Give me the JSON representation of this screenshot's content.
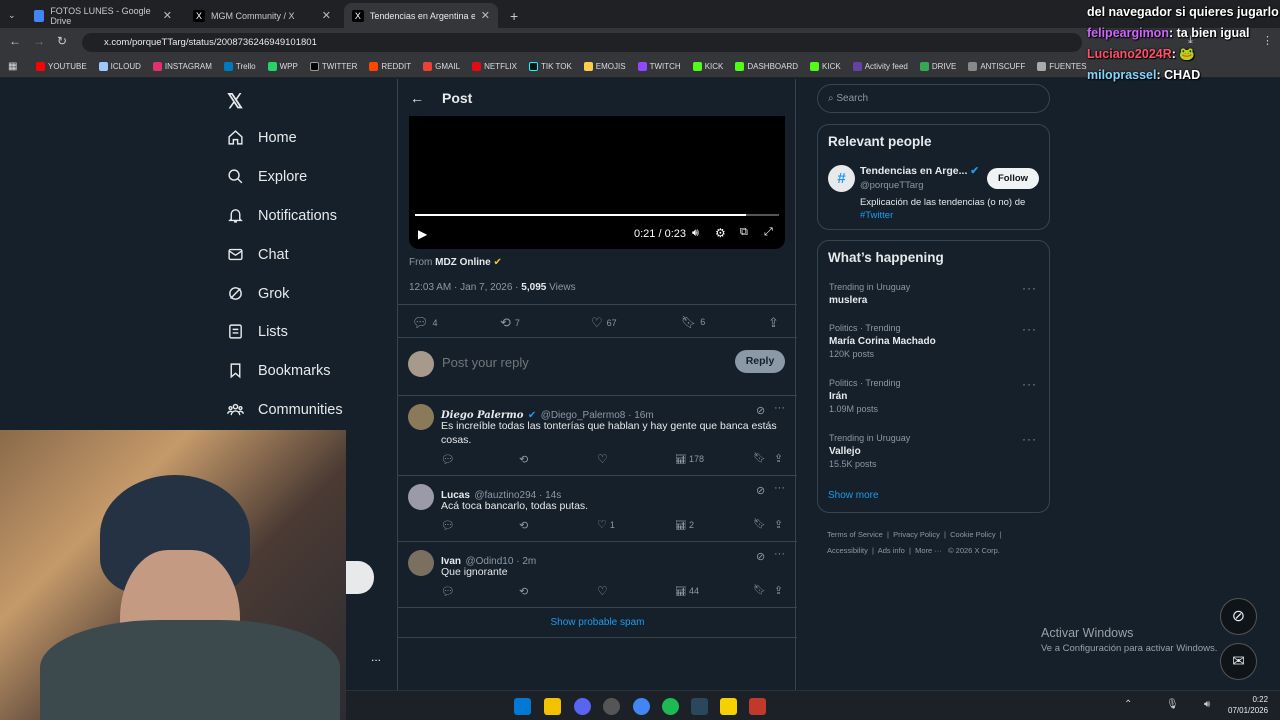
{
  "browser": {
    "tabs": [
      {
        "label": "FOTOS LUNES - Google Drive",
        "active": false
      },
      {
        "label": "MGM Community / X",
        "active": false
      },
      {
        "label": "Tendencias en Argentina en X:",
        "active": true
      }
    ],
    "url": "x.com/porqueTTarg/status/2008736246949101801",
    "bookmarks": [
      "YOUTUBE",
      "ICLOUD",
      "INSTAGRAM",
      "Trello",
      "WPP",
      "TWITTER",
      "REDDIT",
      "GMAIL",
      "NETFLIX",
      "TIK TOK",
      "EMOJIS",
      "TWITCH",
      "KICK",
      "DASHBOARD",
      "KICK",
      "Activity feed",
      "DRIVE",
      "ANTISCUFF",
      "FUENTES"
    ]
  },
  "sidebar": {
    "items": [
      {
        "label": "Home",
        "icon": "home-icon"
      },
      {
        "label": "Explore",
        "icon": "search-icon"
      },
      {
        "label": "Notifications",
        "icon": "bell-icon"
      },
      {
        "label": "Chat",
        "icon": "mail-icon"
      },
      {
        "label": "Grok",
        "icon": "grok-icon"
      },
      {
        "label": "Lists",
        "icon": "list-icon"
      },
      {
        "label": "Bookmarks",
        "icon": "bookmark-icon"
      },
      {
        "label": "Communities",
        "icon": "communities-icon"
      }
    ],
    "more": "..."
  },
  "post": {
    "header": "Post",
    "video_time": "0:21 / 0:23",
    "video_progress": 0.91,
    "from_label": "From",
    "from_source": "MDZ Online",
    "timestamp": "12:03 AM · Jan 7, 2026 ·",
    "views_count": "5,095",
    "views_label": "Views",
    "replies": "4",
    "reposts": "7",
    "likes": "67",
    "bookmarks": "6",
    "reply_placeholder": "Post your reply",
    "reply_button": "Reply"
  },
  "replies": [
    {
      "name": "Diego Palermo",
      "handle": "@Diego_Palermo8 · 16m",
      "text": "Es increíble todas las tonterías que hablan y hay gente que banca estás cosas.",
      "likes": "",
      "views": "178"
    },
    {
      "name": "Lucas",
      "handle": "@fauztino294 · 14s",
      "text": "Acá toca bancarlo, todas putas.",
      "likes": "1",
      "views": "2"
    },
    {
      "name": "Ivan",
      "handle": "@Odind10 · 2m",
      "text": "Que ignorante",
      "likes": "",
      "views": "44"
    }
  ],
  "show_spam": "Show probable spam",
  "search": {
    "placeholder": "Search"
  },
  "relevant": {
    "title": "Relevant people",
    "name": "Tendencias en Arge...",
    "handle": "@porqueTTarg",
    "follow": "Follow",
    "bio": "Explicación de las tendencias (o no) de",
    "bio_tag": "#Twitter"
  },
  "happening": {
    "title": "What’s happening",
    "trends": [
      {
        "context": "Trending in Uruguay",
        "name": "muslera",
        "posts": ""
      },
      {
        "context": "Politics · Trending",
        "name": "María Corina Machado",
        "posts": "120K posts"
      },
      {
        "context": "Politics · Trending",
        "name": "Irán",
        "posts": "1.09M posts"
      },
      {
        "context": "Trending in Uruguay",
        "name": "Vallejo",
        "posts": "15.5K posts"
      }
    ],
    "show_more": "Show more"
  },
  "footer": {
    "line1": [
      "Terms of Service",
      "Privacy Policy",
      "Cookie Policy"
    ],
    "line2": [
      "Accessibility",
      "Ads info",
      "More ···",
      "© 2026 X Corp."
    ]
  },
  "windows": {
    "activate_title": "Activar Windows",
    "activate_sub": "Ve a Configuración para activar Windows.",
    "time": "0:22",
    "date": "07/01/2026"
  },
  "stream_chat": [
    {
      "user": "",
      "text": "del navegador si quieres jugarlo"
    },
    {
      "user": "felipeargimon",
      "text": "ta bien igual",
      "color": "#d063ff"
    },
    {
      "user": "Luciano2024R",
      "text": "",
      "color": "#ff4f6a"
    },
    {
      "user": "miloprassel",
      "text": "CHAD",
      "color": "#7fd7ff"
    }
  ],
  "colors": {
    "accent": "#1d9bf0",
    "bg": "#15202b",
    "border": "#38444d",
    "verified": "#f4c430"
  }
}
